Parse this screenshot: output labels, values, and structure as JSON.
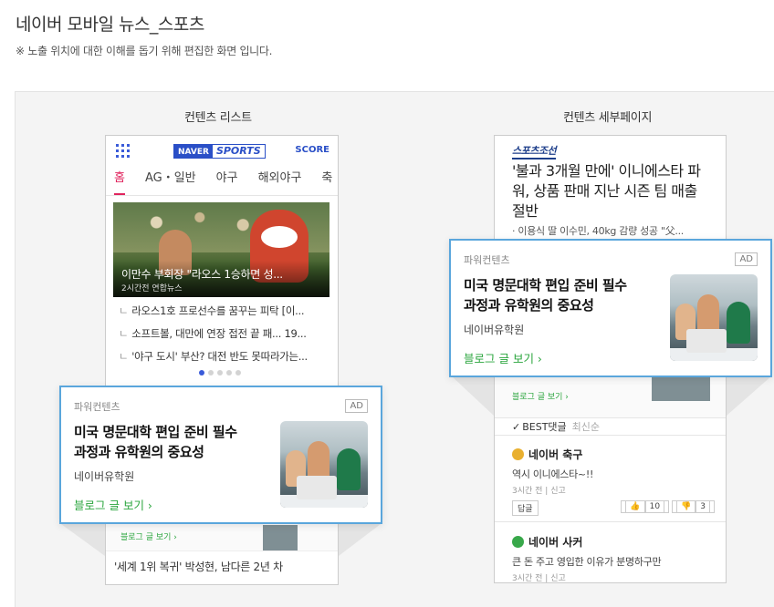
{
  "header": {
    "title": "네이버 모바일 뉴스_스포츠",
    "note": "※ 노출 위치에 대한 이해를 돕기 위해 편집한 화면 입니다."
  },
  "columns": {
    "left_label": "컨텐츠 리스트",
    "right_label": "컨텐츠 세부페이지"
  },
  "left_phone": {
    "logo_naver": "NAVER",
    "logo_sports": "SPORTS",
    "score_label": "SCORE",
    "tabs": [
      "홈",
      "AG・일반",
      "야구",
      "해외야구",
      "축"
    ],
    "active_tab": "홈",
    "hero": {
      "title": "이만수 부회장 \"라오스 1승하면 성...",
      "meta": "2시간전 연합뉴스"
    },
    "news": [
      "라오스1호 프로선수를 꿈꾸는 피탁 [이...",
      "소프트볼, 대만에 연장 접전 끝 패... 19...",
      "'야구 도시' 부산? 대전 반도 못따라가는..."
    ],
    "ghost_link": "블로그 글 보기 ›",
    "bottom_news": "'세계 1위 복귀' 박성현, 남다른 2년 차"
  },
  "right_phone": {
    "press_logo": "스포츠조선",
    "headline": "'불과 3개월 만에' 이니에스타 파워, 상품 판매 지난 시즌 팀 매출 절반",
    "sub_news": "· 이용식 딸 이수민, 40kg 감량 성공 \"父...",
    "ghost_link_1": "블로그 글 보기 ›",
    "ghost_link_2": "블로그 글 보기 ›",
    "ghost_under_text": "불과 3개월 만에",
    "comment_tabs": {
      "best": "BEST댓글",
      "recent": "최신순"
    },
    "comments": [
      {
        "user": "네이버 축구",
        "text": "역시 이니에스타~!!",
        "time": "3시간 전",
        "report": "신고",
        "reply": "답글",
        "likes": "10",
        "dislikes": "3",
        "badge_color": "#e9b030"
      },
      {
        "user": "네이버 사커",
        "text": "큰 돈 주고 영입한 이유가 분명하구만",
        "time": "3시간 전",
        "report": "신고",
        "badge_color": "#38a84a"
      }
    ]
  },
  "ad": {
    "label": "파워컨텐츠",
    "badge": "AD",
    "title_line1": "미국 명문대학 편입 준비 필수",
    "title_line2": "과정과 유학원의 중요성",
    "advertiser": "네이버유학원",
    "link": "블로그 글 보기 ›",
    "border_color": "#5aa6dc",
    "link_color": "#2aa53d"
  }
}
